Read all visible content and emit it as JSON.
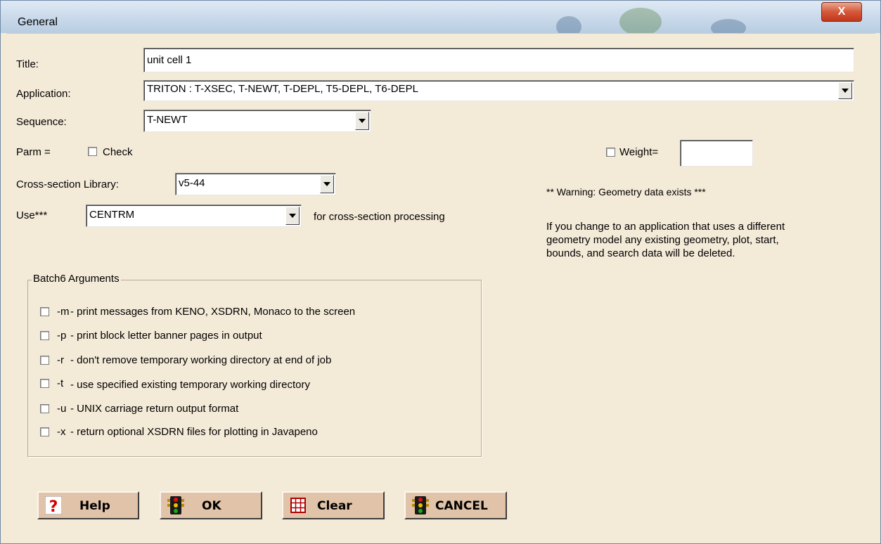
{
  "window": {
    "title": "General",
    "close_label": "X"
  },
  "title_field": {
    "label": "Title:",
    "value": "unit cell 1"
  },
  "application": {
    "label": "Application:",
    "selected": "TRITON : T-XSEC, T-NEWT, T-DEPL, T5-DEPL, T6-DEPL"
  },
  "sequence": {
    "label": "Sequence:",
    "selected": "T-NEWT"
  },
  "parm": {
    "label": "Parm =",
    "check_label": "Check",
    "checked": false
  },
  "weight": {
    "label": "Weight=",
    "value": "",
    "checked": false
  },
  "xs_library": {
    "label": "Cross-section Library:",
    "selected": "v5-44"
  },
  "use": {
    "label": "Use***",
    "selected": "CENTRM",
    "suffix": "for cross-section processing"
  },
  "warning": {
    "title": "** Warning: Geometry data exists ***",
    "message": "If you change to an application that uses a different geometry model any existing geometry, plot, start, bounds, and search data will be deleted."
  },
  "batch6": {
    "title": "Batch6 Arguments",
    "options": [
      {
        "flag": "-m",
        "desc": "- print messages from KENO, XSDRN, Monaco to the screen",
        "checked": false
      },
      {
        "flag": "-p",
        "desc": "- print block letter banner pages in output",
        "checked": false
      },
      {
        "flag": "-r",
        "desc": "- don't remove temporary working directory at end of job",
        "checked": false
      },
      {
        "flag": "-t",
        "desc": "- use specified existing temporary working directory",
        "checked": false
      },
      {
        "flag": "-u",
        "desc": "- UNIX carriage return output format",
        "checked": false
      },
      {
        "flag": "-x",
        "desc": "- return optional XSDRN files for plotting in Javapeno",
        "checked": false
      }
    ]
  },
  "buttons": {
    "help": {
      "label": "Help",
      "icon": "question-mark-icon"
    },
    "ok": {
      "label": "OK",
      "icon": "traffic-light-icon"
    },
    "clear": {
      "label": "Clear",
      "icon": "grid-icon"
    },
    "cancel": {
      "label": "CANCEL",
      "icon": "traffic-light-icon"
    }
  },
  "colors": {
    "dialog_bg": "#f4ead8",
    "button_bg": "#e0c3a8",
    "close_red": "#c2371b"
  }
}
